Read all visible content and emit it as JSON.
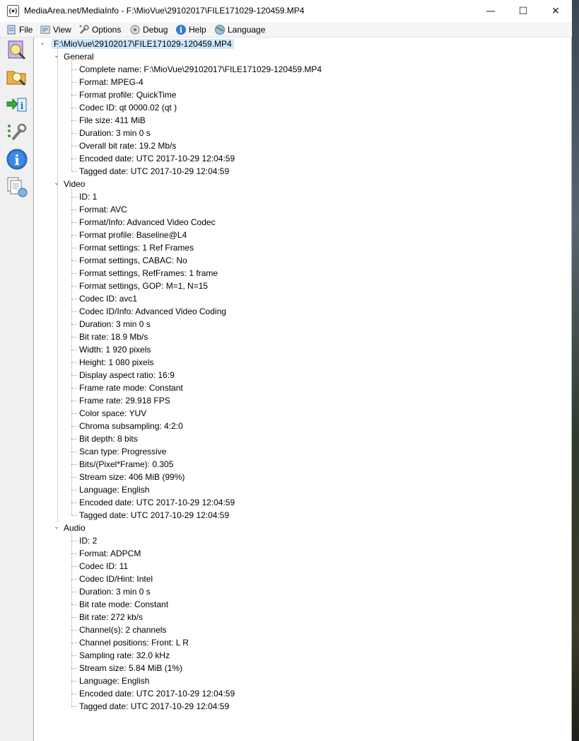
{
  "window": {
    "title": "MediaArea.net/MediaInfo - F:\\MioVue\\29102017\\FILE171029-120459.MP4",
    "controls": {
      "minimize": "—",
      "maximize": "☐",
      "close": "✕"
    }
  },
  "menu": [
    {
      "label": "File",
      "icon": "file-icon"
    },
    {
      "label": "View",
      "icon": "view-icon"
    },
    {
      "label": "Options",
      "icon": "options-icon"
    },
    {
      "label": "Debug",
      "icon": "debug-icon"
    },
    {
      "label": "Help",
      "icon": "help-icon"
    },
    {
      "label": "Language",
      "icon": "language-icon"
    }
  ],
  "toolbar": [
    {
      "icon": "open-file-icon"
    },
    {
      "icon": "open-folder-icon"
    },
    {
      "icon": "export-icon"
    },
    {
      "icon": "preferences-icon"
    },
    {
      "icon": "about-icon"
    },
    {
      "icon": "knowledge-base-icon"
    }
  ],
  "tree": {
    "root": "F:\\MioVue\\29102017\\FILE171029-120459.MP4",
    "sections": [
      {
        "name": "General",
        "items": [
          "Complete name: F:\\MioVue\\29102017\\FILE171029-120459.MP4",
          "Format: MPEG-4",
          "Format profile: QuickTime",
          "Codec ID: qt   0000.02 (qt  )",
          "File size: 411 MiB",
          "Duration: 3 min 0 s",
          "Overall bit rate: 19.2 Mb/s",
          "Encoded date: UTC 2017-10-29 12:04:59",
          "Tagged date: UTC 2017-10-29 12:04:59"
        ]
      },
      {
        "name": "Video",
        "items": [
          "ID: 1",
          "Format: AVC",
          "Format/Info: Advanced Video Codec",
          "Format profile: Baseline@L4",
          "Format settings: 1 Ref Frames",
          "Format settings, CABAC: No",
          "Format settings, RefFrames: 1 frame",
          "Format settings, GOP: M=1, N=15",
          "Codec ID: avc1",
          "Codec ID/Info: Advanced Video Coding",
          "Duration: 3 min 0 s",
          "Bit rate: 18.9 Mb/s",
          "Width: 1 920 pixels",
          "Height: 1 080 pixels",
          "Display aspect ratio: 16:9",
          "Frame rate mode: Constant",
          "Frame rate: 29.918 FPS",
          "Color space: YUV",
          "Chroma subsampling: 4:2:0",
          "Bit depth: 8 bits",
          "Scan type: Progressive",
          "Bits/(Pixel*Frame): 0.305",
          "Stream size: 406 MiB (99%)",
          "Language: English",
          "Encoded date: UTC 2017-10-29 12:04:59",
          "Tagged date: UTC 2017-10-29 12:04:59"
        ]
      },
      {
        "name": "Audio",
        "items": [
          "ID: 2",
          "Format: ADPCM",
          "Codec ID: 11",
          "Codec ID/Hint: Intel",
          "Duration: 3 min 0 s",
          "Bit rate mode: Constant",
          "Bit rate: 272 kb/s",
          "Channel(s): 2 channels",
          "Channel positions: Front: L R",
          "Sampling rate: 32.0 kHz",
          "Stream size: 5.84 MiB (1%)",
          "Language: English",
          "Encoded date: UTC 2017-10-29 12:04:59",
          "Tagged date: UTC 2017-10-29 12:04:59"
        ]
      }
    ]
  },
  "colors": {
    "selection": "#cce8ff",
    "toolbar_bg": "#f0f0f0",
    "menubar_bg": "#f5f5f5"
  }
}
